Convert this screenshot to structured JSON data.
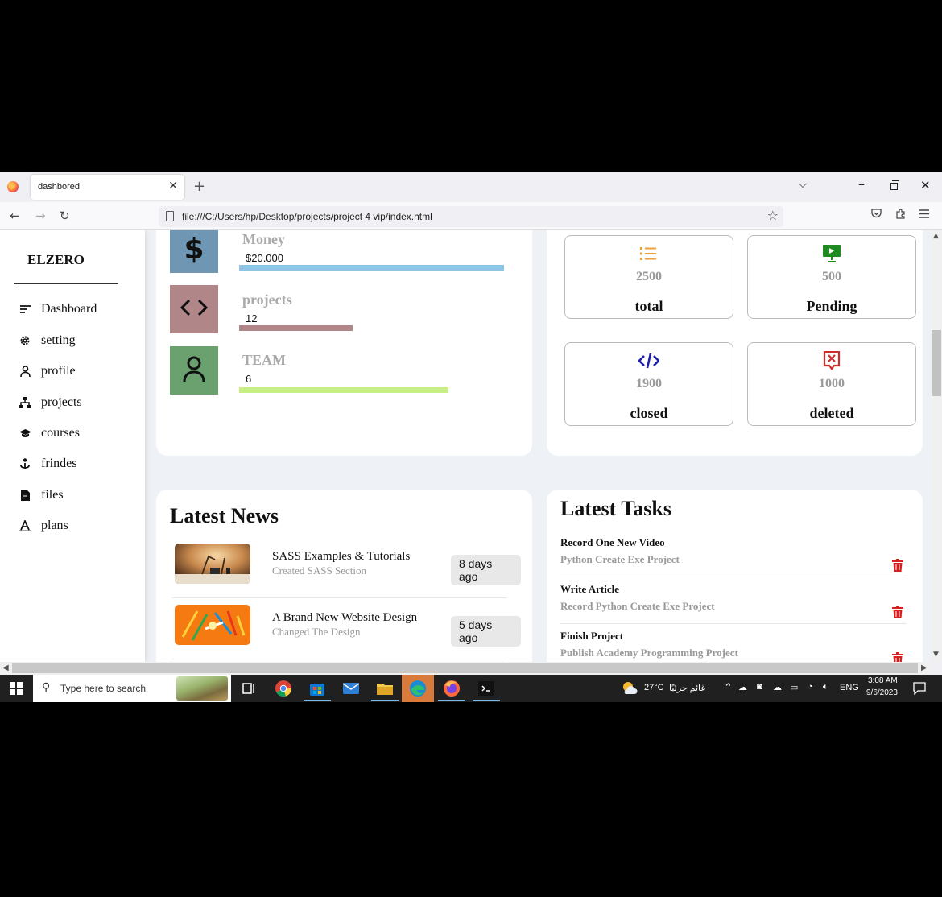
{
  "browser": {
    "tab_title": "dashbored",
    "url": "file:///C:/Users/hp/Desktop/projects/project 4 vip/index.html"
  },
  "sidebar": {
    "brand": "ELZERO",
    "items": [
      {
        "label": "Dashboard",
        "icon": "list-icon"
      },
      {
        "label": "setting",
        "icon": "gear-icon"
      },
      {
        "label": "profile",
        "icon": "user-icon"
      },
      {
        "label": "projects",
        "icon": "sitemap-icon"
      },
      {
        "label": "courses",
        "icon": "graduation-cap-icon"
      },
      {
        "label": "frindes",
        "icon": "friends-icon"
      },
      {
        "label": "files",
        "icon": "file-icon"
      },
      {
        "label": "plans",
        "icon": "plans-icon"
      }
    ]
  },
  "stats": [
    {
      "title": "Money",
      "value": "$20.000",
      "icon": "dollar-icon",
      "color": "#6f96b2",
      "bar_color": "#8ec4e4",
      "progress": 1.0
    },
    {
      "title": "projects",
      "value": "12",
      "icon": "code-icon",
      "color": "#b08688",
      "bar_color": "#b08688",
      "progress": 0.43
    },
    {
      "title": "TEAM",
      "value": "6",
      "icon": "user-icon",
      "color": "#6aa16e",
      "bar_color": "#c7ef86",
      "progress": 0.79
    }
  ],
  "tickets": [
    {
      "number": "2500",
      "label": "total",
      "icon": "list-icon",
      "color": "#e8a33a"
    },
    {
      "number": "500",
      "label": "Pending",
      "icon": "presentation-icon",
      "color": "#1f8a1f"
    },
    {
      "number": "1900",
      "label": "closed",
      "icon": "code-icon",
      "color": "#1d1da8"
    },
    {
      "number": "1000",
      "label": "deleted",
      "icon": "rectangle-xmark-icon",
      "color": "#d22b2b"
    }
  ],
  "news": {
    "title": "Latest News",
    "items": [
      {
        "title": "SASS Examples & Tutorials",
        "desc": "Created SASS Section",
        "date": "8 days ago"
      },
      {
        "title": "A Brand New Website Design",
        "desc": "Changed The Design",
        "date": "5 days ago"
      }
    ]
  },
  "tasks": {
    "title": "Latest Tasks",
    "items": [
      {
        "title": "Record One New Video",
        "desc": "Python Create Exe Project"
      },
      {
        "title": "Write Article",
        "desc": "Record Python Create Exe Project"
      },
      {
        "title": "Finish Project",
        "desc": "Publish Academy Programming Project"
      }
    ],
    "delete_color": "#d61f1f"
  },
  "taskbar": {
    "search_placeholder": "Type here to search",
    "weather_temp": "27°C",
    "weather_desc": "غائم جزئيًا",
    "language": "ENG",
    "time": "3:08 AM",
    "date": "9/6/2023"
  }
}
